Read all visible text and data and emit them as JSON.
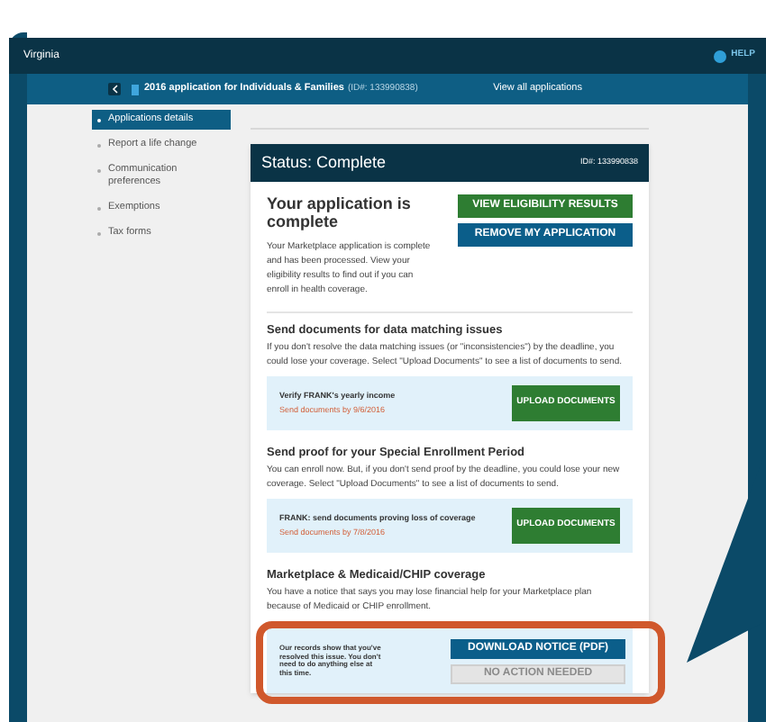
{
  "top_bar": {
    "state": "Virginia",
    "help": "HELP"
  },
  "app_bar": {
    "title": "2016 application for Individuals & Families",
    "id": "(ID#: 133990838)",
    "link": "View all applications"
  },
  "sidebar": {
    "items": [
      {
        "label": "Applications details",
        "selected": true
      },
      {
        "label": "Report a life change",
        "selected": false
      },
      {
        "label": "Communication preferences",
        "selected": false
      },
      {
        "label": "Exemptions",
        "selected": false
      },
      {
        "label": "Tax forms",
        "selected": false
      }
    ]
  },
  "status_card": {
    "title": "Status: Complete",
    "id": "ID#: 133990838",
    "heading": "Your application is complete",
    "description": "Your Marketplace application is complete and has been processed. View your eligibility results to find out if you can enroll in health coverage.",
    "buttons": [
      {
        "label": "VIEW ELIGIBILITY RESULTS",
        "kind": "green"
      },
      {
        "label": "REMOVE MY APPLICATION",
        "kind": "blue"
      }
    ],
    "sections": [
      {
        "title": "Send documents for data matching issues",
        "body": "If you don't resolve the data matching issues (or \"inconsistencies\") by the deadline, you could lose your coverage. Select \"Upload Documents\" to see a list of documents to send.",
        "task": {
          "kind": "upload",
          "title": "Verify FRANK's yearly income",
          "due": "Send documents by 9/6/2016",
          "buttons": [
            {
              "label": "UPLOAD DOCUMENTS",
              "kind": "green",
              "disabled": false
            }
          ]
        }
      },
      {
        "title": "Send proof for your Special Enrollment Period",
        "body": "You can enroll now. But, if you don't send proof by the deadline, you could lose your new coverage. Select \"Upload Documents\" to see a list of documents to send.",
        "task": {
          "kind": "upload",
          "title": "FRANK: send documents proving loss of coverage",
          "due": "Send documents by 7/8/2016",
          "buttons": [
            {
              "label": "UPLOAD DOCUMENTS",
              "kind": "green",
              "disabled": false
            }
          ]
        }
      },
      {
        "title": "Marketplace & Medicaid/CHIP coverage",
        "body": "You have a notice that says you may lose financial help for your Marketplace plan because of Medicaid or CHIP enrollment.",
        "task": {
          "kind": "resolved",
          "title": "Our records show that you've resolved this issue. You don't need to do anything else at this time.",
          "buttons": [
            {
              "label": "DOWNLOAD NOTICE (PDF)",
              "kind": "blue",
              "disabled": false
            },
            {
              "label": "NO ACTION NEEDED",
              "kind": "grey",
              "disabled": true
            }
          ]
        }
      }
    ]
  }
}
